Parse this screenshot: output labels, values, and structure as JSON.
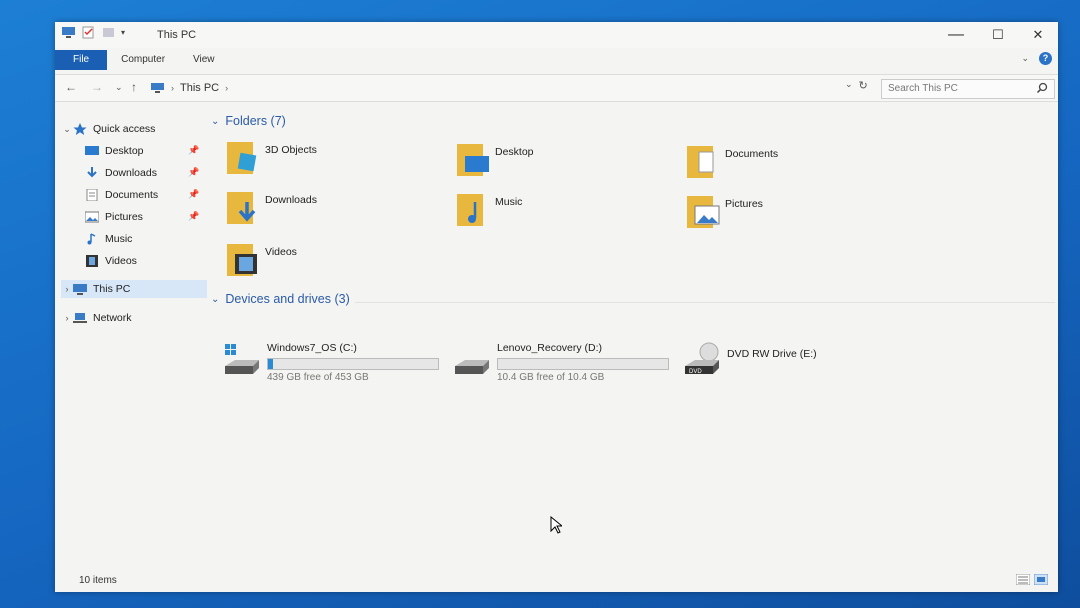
{
  "window": {
    "title": "This PC",
    "controls": [
      "—",
      "☐",
      "✕"
    ]
  },
  "ribbon": {
    "tabs": [
      "File",
      "Computer",
      "View"
    ]
  },
  "address": {
    "crumb": "This PC",
    "search_placeholder": "Search This PC"
  },
  "nav": {
    "quick_access": "Quick access",
    "items": [
      "Desktop",
      "Downloads",
      "Documents",
      "Pictures",
      "Music",
      "Videos"
    ],
    "this_pc": "This PC",
    "network": "Network"
  },
  "main": {
    "folders_header": "Folders (7)",
    "folders": [
      "3D Objects",
      "Desktop",
      "Documents",
      "Downloads",
      "Music",
      "Pictures",
      "Videos"
    ],
    "drives_header": "Devices and drives (3)",
    "drives": [
      {
        "name": "Windows7_OS (C:)",
        "free": "439 GB free of 453 GB",
        "used_fraction": 0.03
      },
      {
        "name": "Lenovo_Recovery (D:)",
        "free": "10.4 GB free of 10.4 GB",
        "used_fraction": 0.0
      },
      {
        "name": "DVD RW Drive (E:)"
      }
    ]
  },
  "status": {
    "count": "10 items"
  },
  "colors": {
    "accent": "#1a5fb4",
    "folder": "#e8b73e",
    "desktop_bg": "#1566c0"
  }
}
